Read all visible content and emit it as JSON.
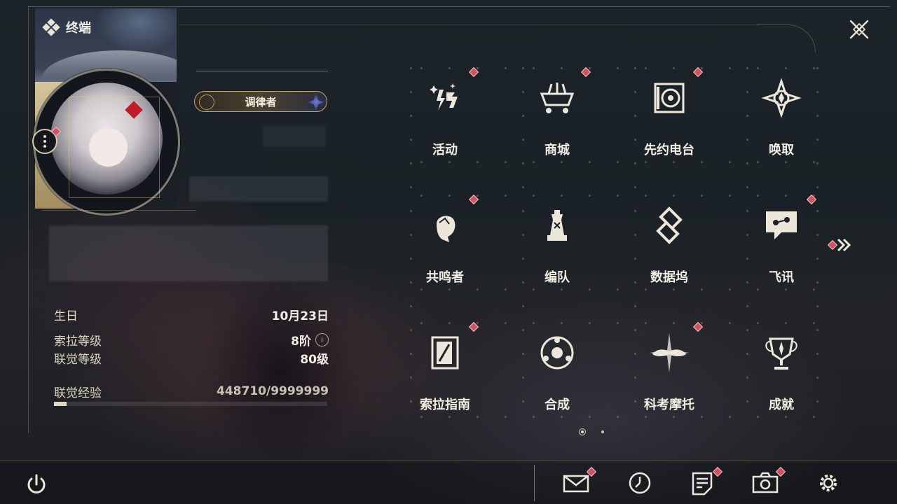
{
  "terminal": {
    "title": "终端"
  },
  "profile": {
    "title_badge": "调律者",
    "stats": [
      {
        "label": "生日",
        "value": "10月23日"
      },
      {
        "label": "索拉等级",
        "value": "8阶",
        "info": "i"
      },
      {
        "label": "联觉等级",
        "value": "80级"
      },
      {
        "label": "联觉经验",
        "value": "448710/9999999"
      }
    ],
    "exp_fraction": 0.045
  },
  "menu": [
    {
      "label": "活动",
      "icon": "event-sparkle-icon",
      "badge": true
    },
    {
      "label": "商城",
      "icon": "shop-basket-icon",
      "badge": true
    },
    {
      "label": "先约电台",
      "icon": "radio-pass-icon",
      "badge": true
    },
    {
      "label": "唤取",
      "icon": "convene-compass-icon",
      "badge": false
    },
    {
      "label": "共鸣者",
      "icon": "resonator-head-icon",
      "badge": true
    },
    {
      "label": "编队",
      "icon": "team-chess-icon",
      "badge": false
    },
    {
      "label": "数据坞",
      "icon": "data-bank-icon",
      "badge": false
    },
    {
      "label": "飞讯",
      "icon": "message-chat-icon",
      "badge": true
    },
    {
      "label": "索拉指南",
      "icon": "guidebook-icon",
      "badge": true
    },
    {
      "label": "合成",
      "icon": "synthesis-icon",
      "badge": false
    },
    {
      "label": "科考摩托",
      "icon": "motorcycle-icon",
      "badge": true
    },
    {
      "label": "成就",
      "icon": "trophy-icon",
      "badge": false
    }
  ],
  "pager": {
    "current": 1,
    "total": 2
  },
  "bottom_bar": [
    {
      "name": "mail",
      "icon": "mail-icon",
      "badge": true
    },
    {
      "name": "time",
      "icon": "clock-icon",
      "badge": false
    },
    {
      "name": "notice",
      "icon": "notice-icon",
      "badge": true
    },
    {
      "name": "camera",
      "icon": "camera-icon",
      "badge": true
    },
    {
      "name": "settings",
      "icon": "gear-icon",
      "badge": false
    }
  ],
  "colors": {
    "badge": "#d0525e",
    "text": "#f1ede3",
    "accent_gold": "#bfa873"
  }
}
